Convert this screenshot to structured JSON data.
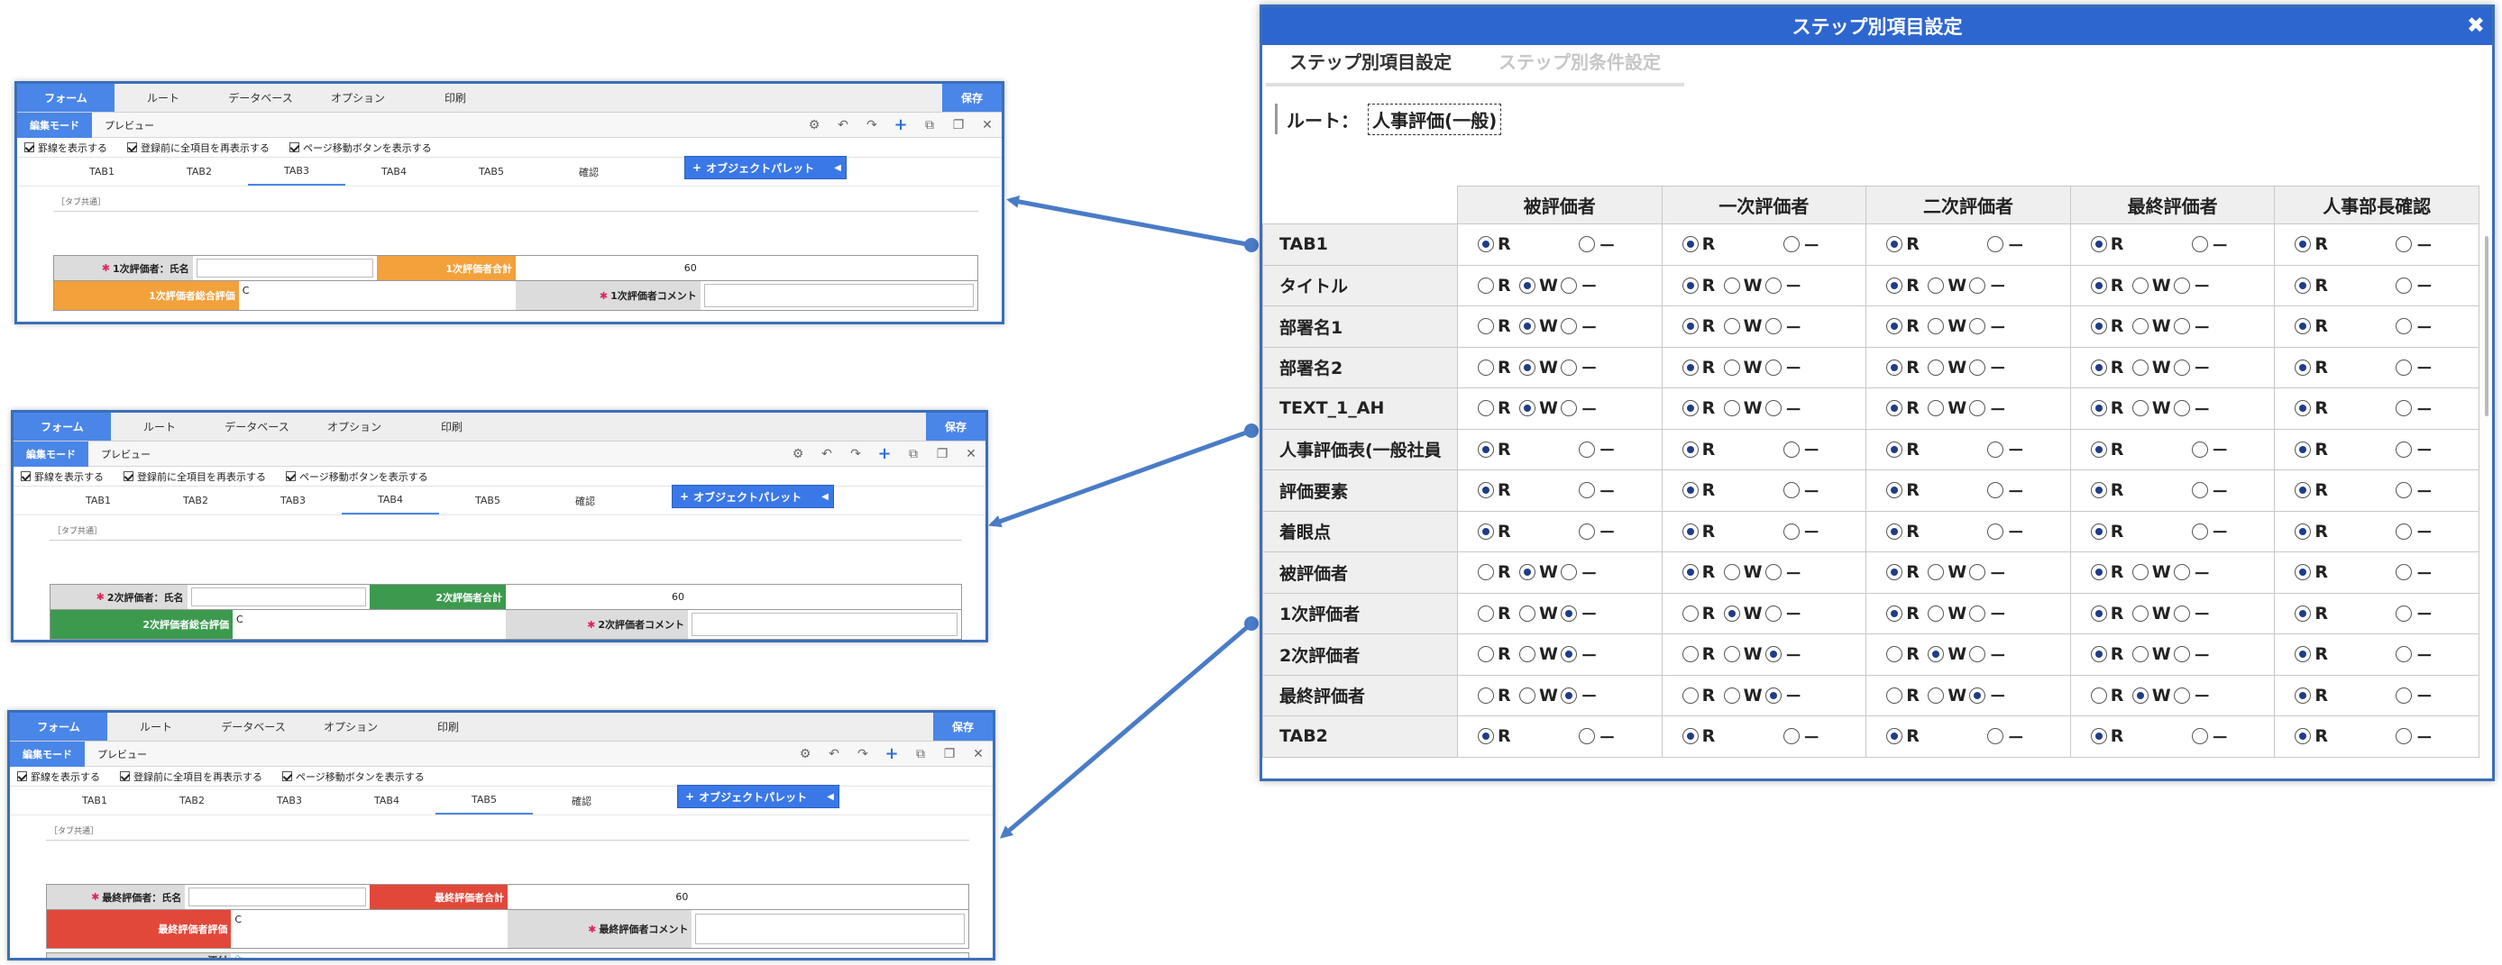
{
  "colors": {
    "blue": "#4a86e8",
    "orange": "#f2a13b",
    "green": "#3c9a4e",
    "red": "#e2483a",
    "arrow": "#4a7cc7"
  },
  "editor": {
    "top_tabs": [
      "フォーム",
      "ルート",
      "データベース",
      "オプション",
      "印刷"
    ],
    "save_label": "保存",
    "modes": [
      "編集モード",
      "プレビュー"
    ],
    "toolbar_icons": [
      "gear-icon",
      "undo-icon",
      "redo-icon",
      "add-icon",
      "copy-icon",
      "paste-icon",
      "close-icon"
    ],
    "checks": [
      "罫線を表示する",
      "登録前に全項目を再表示する",
      "ページ移動ボタンを表示する"
    ],
    "form_tabs": [
      "TAB1",
      "TAB2",
      "TAB3",
      "TAB4",
      "TAB5",
      "確認"
    ],
    "palette_label": "オブジェクトパレット",
    "tab_common": "［タブ共通］"
  },
  "panels": [
    {
      "active_tab": 2,
      "name_label": "1次評価者：氏名",
      "total_label": "1次評価者合計",
      "total_value": "60",
      "overall_label": "1次評価者総合評価",
      "overall_value": "C",
      "comment_label": "1次評価者コメント",
      "accent": "#f2a13b"
    },
    {
      "active_tab": 3,
      "name_label": "2次評価者：氏名",
      "total_label": "2次評価者合計",
      "total_value": "60",
      "overall_label": "2次評価者総合評価",
      "overall_value": "C",
      "comment_label": "2次評価者コメント",
      "accent": "#3c9a4e"
    },
    {
      "active_tab": 4,
      "name_label": "最終評価者：氏名",
      "total_label": "最終評価者合計",
      "total_value": "60",
      "overall_label": "最終評価者評価",
      "overall_value": "C",
      "comment_label": "最終評価者コメント",
      "accent": "#e2483a",
      "attach_label": "添付"
    }
  ],
  "dialog": {
    "title": "ステップ別項目設定",
    "tabs": [
      "ステップ別項目設定",
      "ステップ別条件設定"
    ],
    "route_label": "ルート：",
    "route_value": "人事評価(一般)",
    "columns": [
      "被評価者",
      "一次評価者",
      "二次評価者",
      "最終評価者",
      "人事部長確認"
    ],
    "rows": [
      {
        "label": "TAB1",
        "cells": [
          "R2",
          "R2",
          "R2",
          "R2",
          "R2"
        ]
      },
      {
        "label": "タイトル",
        "cells": [
          "W",
          "R",
          "R",
          "R",
          "R2"
        ]
      },
      {
        "label": "部署名1",
        "cells": [
          "W",
          "R",
          "R",
          "R",
          "R2"
        ]
      },
      {
        "label": "部署名2",
        "cells": [
          "W",
          "R",
          "R",
          "R",
          "R2"
        ]
      },
      {
        "label": "TEXT_1_AH",
        "cells": [
          "W",
          "R",
          "R",
          "R",
          "R2"
        ]
      },
      {
        "label": "人事評価表(一般社員",
        "cells": [
          "R2",
          "R2",
          "R2",
          "R2",
          "R2"
        ]
      },
      {
        "label": "評価要素",
        "cells": [
          "R2",
          "R2",
          "R2",
          "R2",
          "R2"
        ]
      },
      {
        "label": "着眼点",
        "cells": [
          "R2",
          "R2",
          "R2",
          "R2",
          "R2"
        ]
      },
      {
        "label": "被評価者",
        "cells": [
          "W",
          "R",
          "R",
          "R",
          "R2"
        ]
      },
      {
        "label": "1次評価者",
        "cells": [
          "-",
          "W",
          "R",
          "R",
          "R2"
        ]
      },
      {
        "label": "2次評価者",
        "cells": [
          "-",
          "-",
          "W",
          "R",
          "R2"
        ]
      },
      {
        "label": "最終評価者",
        "cells": [
          "-",
          "-",
          "-",
          "W",
          "R2"
        ]
      },
      {
        "label": "TAB2",
        "cells": [
          "R2",
          "R2",
          "R2",
          "R2",
          "R2"
        ]
      }
    ],
    "opt_R": "R",
    "opt_W": "W",
    "opt_dash": "－"
  }
}
